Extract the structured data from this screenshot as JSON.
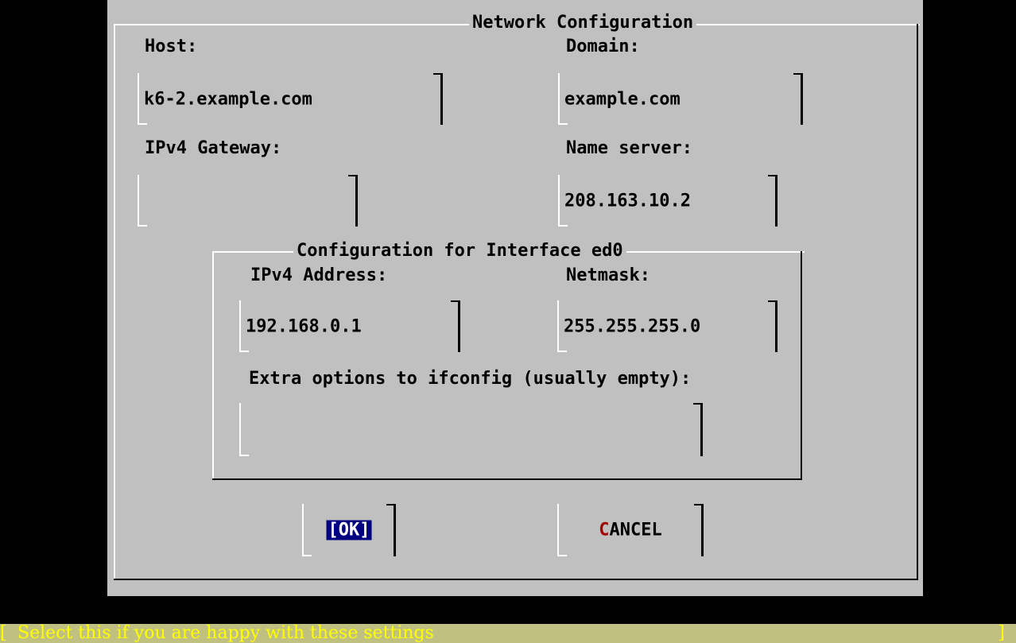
{
  "dialog": {
    "title": "Network Configuration",
    "host": {
      "label": "Host:",
      "value": "k6-2.example.com"
    },
    "domain": {
      "label": "Domain:",
      "value": "example.com"
    },
    "gateway": {
      "label": "IPv4 Gateway:",
      "value": ""
    },
    "nameserver": {
      "label": "Name server:",
      "value": "208.163.10.2"
    },
    "interface": {
      "title": "Configuration for Interface ed0",
      "ipv4": {
        "label": "IPv4 Address:",
        "value": "192.168.0.1"
      },
      "netmask": {
        "label": "Netmask:",
        "value": "255.255.255.0"
      },
      "extra": {
        "label": "Extra options to ifconfig (usually empty):",
        "value": ""
      }
    },
    "buttons": {
      "ok": "[OK]",
      "cancel_hot": "C",
      "cancel_rest": "ANCEL"
    }
  },
  "status": {
    "left_bracket": "[",
    "text": "Select this if you are happy with these settings",
    "right_bracket": "]"
  },
  "colors": {
    "background": "#000000",
    "dialog": "#c0c0c0",
    "selection": "#000080",
    "hotkey": "#a00000",
    "status_text": "#ffff00"
  }
}
